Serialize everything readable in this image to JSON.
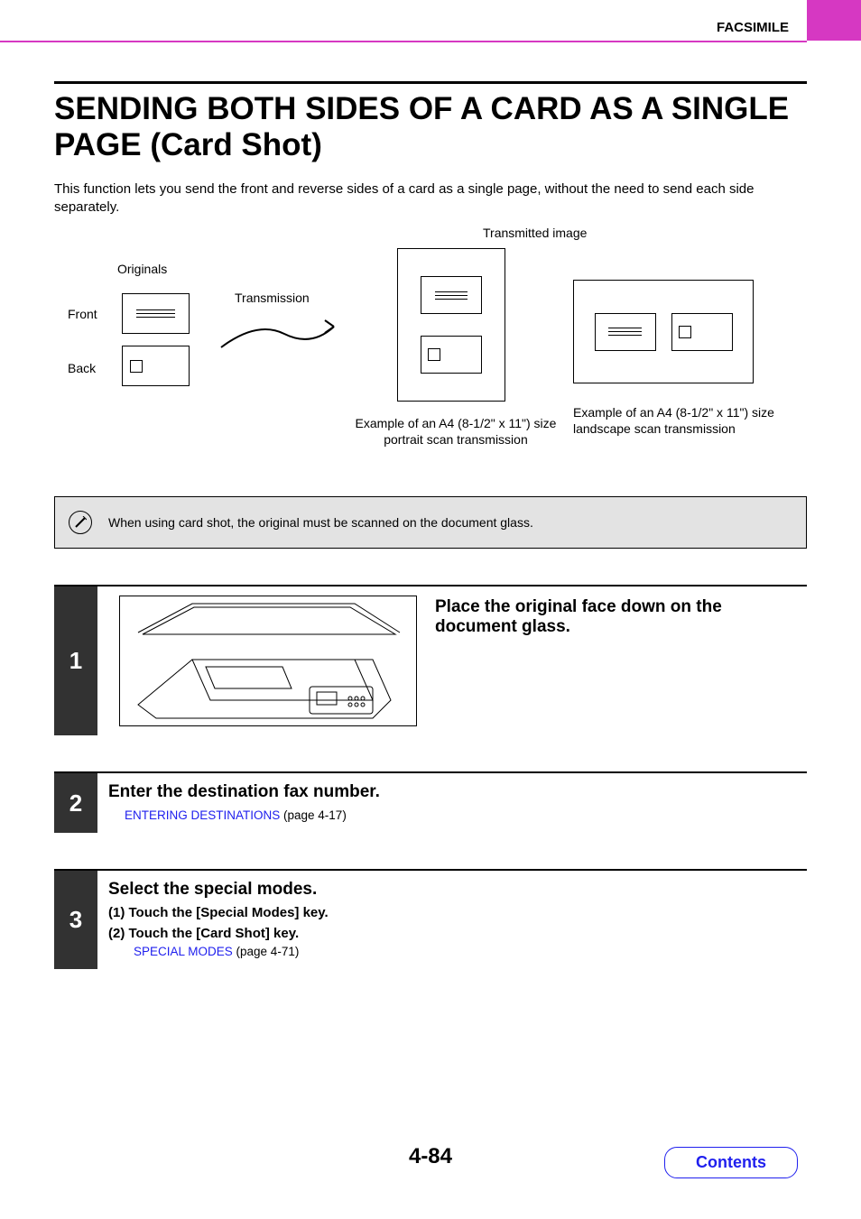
{
  "header": {
    "section": "FACSIMILE"
  },
  "title": "SENDING BOTH SIDES OF A CARD AS A SINGLE PAGE (Card Shot)",
  "intro": "This function lets you send the front and reverse sides of a card as a single page, without the need to send each side separately.",
  "diagram": {
    "originals": "Originals",
    "front": "Front",
    "back": "Back",
    "transmission": "Transmission",
    "transmitted": "Transmitted image",
    "portrait_caption": "Example of an A4 (8-1/2\" x 11\") size portrait scan transmission",
    "landscape_caption": "Example of an A4 (8-1/2\" x 11\") size landscape scan transmission"
  },
  "note": "When using card shot, the original must be scanned on the document glass.",
  "steps": {
    "s1": {
      "num": "1",
      "heading": "Place the original face down on the document glass."
    },
    "s2": {
      "num": "2",
      "heading": "Enter the destination fax number.",
      "link": "ENTERING DESTINATIONS",
      "link_ref": " (page 4-17)"
    },
    "s3": {
      "num": "3",
      "heading": "Select the special modes.",
      "item1": "(1)  Touch the [Special Modes] key.",
      "item2": "(2)  Touch the [Card Shot] key.",
      "link": "SPECIAL MODES",
      "link_ref": " (page 4-71)"
    }
  },
  "footer": {
    "page_number": "4-84",
    "contents": "Contents"
  }
}
